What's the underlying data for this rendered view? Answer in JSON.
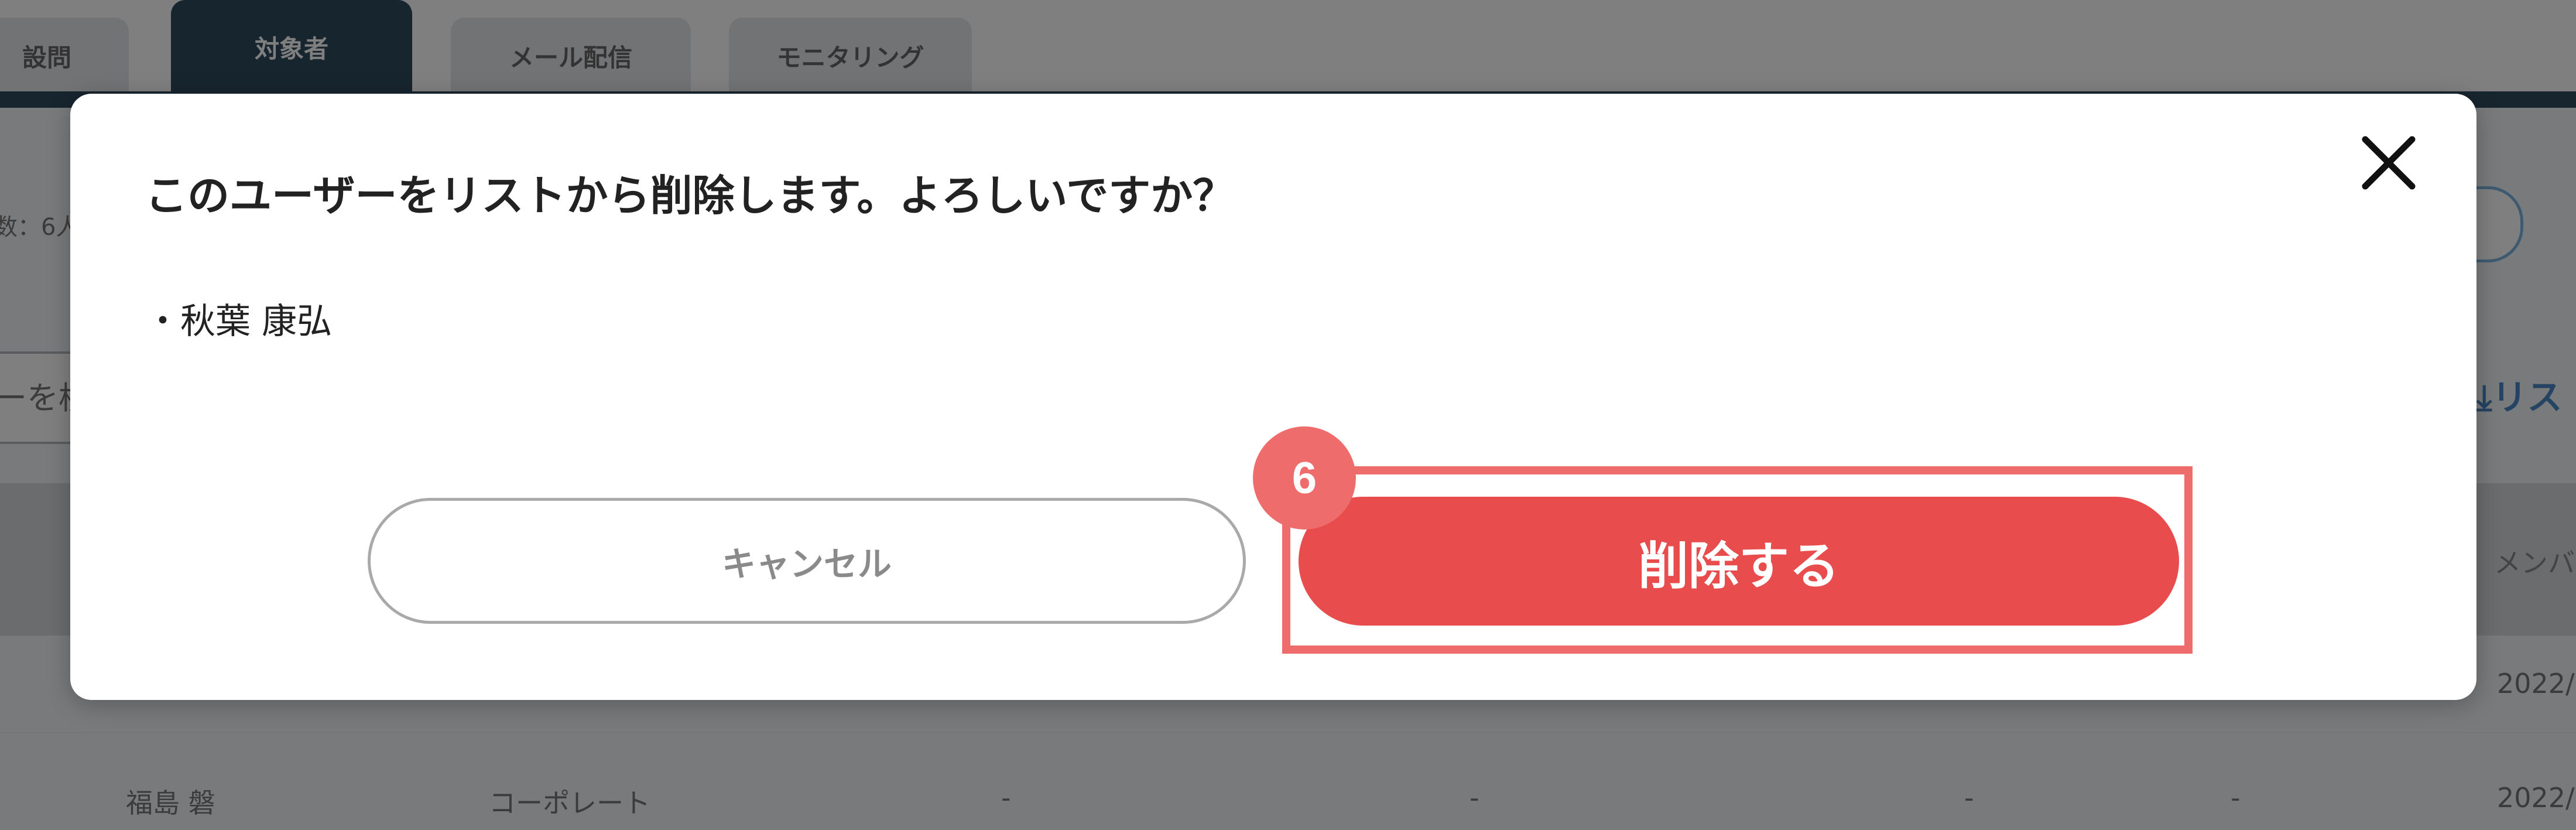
{
  "tabs": [
    {
      "label": "設問"
    },
    {
      "label": "対象者"
    },
    {
      "label": "メール配信"
    },
    {
      "label": "モニタリング"
    }
  ],
  "background": {
    "count_text": "数：6人",
    "search_placeholder": "ーを検",
    "download_link": "リス",
    "header_col": "メンバ",
    "row1_date": "2022/",
    "row2_name": "福島 磐",
    "row2_dept": "コーポレート",
    "row2_dash": "-",
    "row2_date": "2022/"
  },
  "modal": {
    "title": "このユーザーをリストから削除します。よろしいですか？",
    "items": [
      "・秋葉 康弘"
    ],
    "cancel_label": "キャンセル",
    "delete_label": "削除する",
    "step_number": "6"
  },
  "colors": {
    "primary_dark": "#2f4a5e",
    "danger": "#e84c4c",
    "highlight": "#ef6c6c"
  }
}
